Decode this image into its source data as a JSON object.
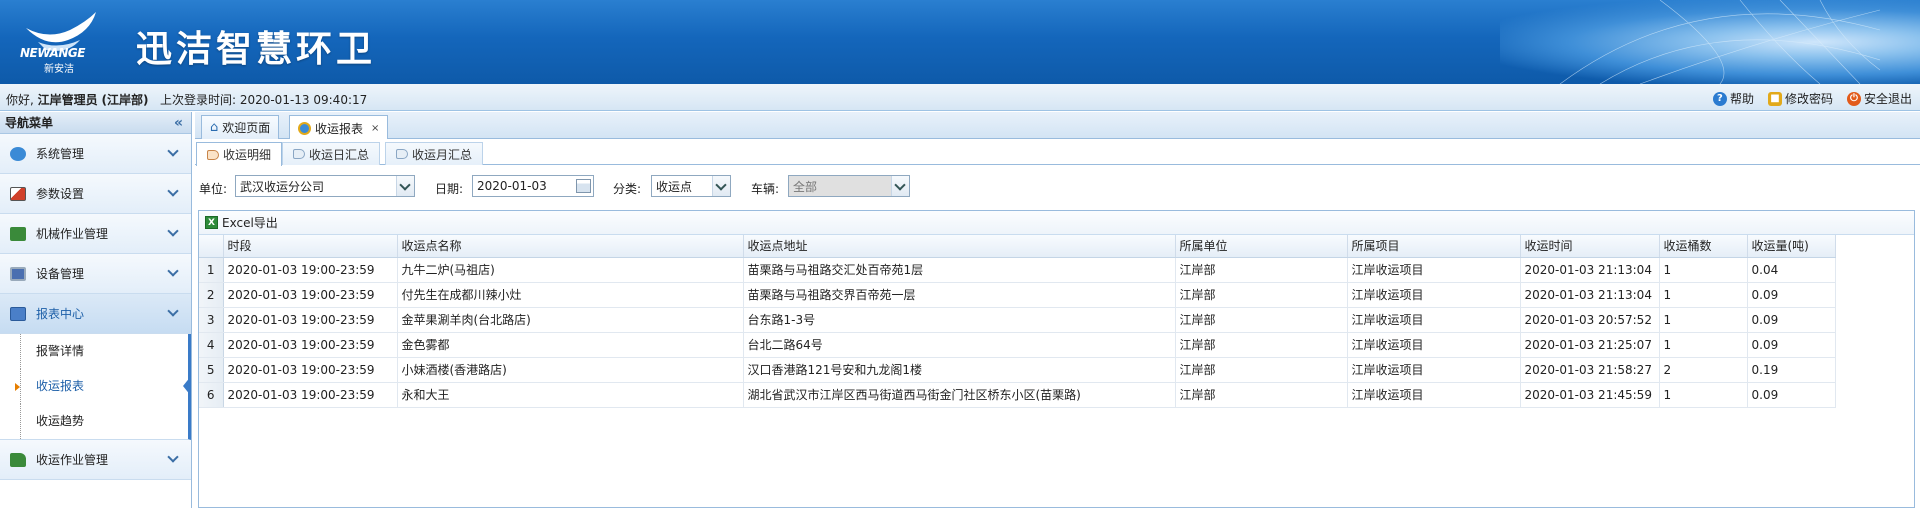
{
  "header": {
    "logo_text": "NEWANGE",
    "logo_sub": "新安洁",
    "app_title": "迅洁智慧环卫"
  },
  "infobar": {
    "greeting_prefix": "你好,",
    "user": "江岸管理员",
    "dept": "(江岸部)",
    "last_login_label": "上次登录时间:",
    "last_login": "2020-01-13 09:40:17",
    "links": [
      {
        "label": "帮助",
        "icon": "help-icon",
        "color": "#2b7bd0"
      },
      {
        "label": "修改密码",
        "icon": "lock-icon",
        "color": "#e2a91a"
      },
      {
        "label": "安全退出",
        "icon": "power-icon",
        "color": "#e25a1a"
      }
    ]
  },
  "sidebar": {
    "title": "导航菜单",
    "collapse_icon": "«",
    "items": [
      {
        "label": "系统管理",
        "icon": "system-icon",
        "color": "#3a8ad6"
      },
      {
        "label": "参数设置",
        "icon": "chart-params-icon",
        "color": "#d0402a"
      },
      {
        "label": "机械作业管理",
        "icon": "truck-icon",
        "color": "#3a8a3a"
      },
      {
        "label": "设备管理",
        "icon": "monitor-icon",
        "color": "#4a6fb0"
      },
      {
        "label": "报表中心",
        "icon": "report-icon",
        "color": "#4a7fc8"
      },
      {
        "label": "收运作业管理",
        "icon": "garbage-truck-icon",
        "color": "#3a8a3a"
      }
    ],
    "sub_items": [
      "报警详情",
      "收运报表",
      "收运趋势"
    ]
  },
  "tabs": [
    {
      "label": "欢迎页面",
      "icon": "home-icon"
    },
    {
      "label": "收运报表",
      "icon": "report-tab-icon",
      "close": "×"
    }
  ],
  "subtabs": [
    "收运明细",
    "收运日汇总",
    "收运月汇总"
  ],
  "filters": {
    "unit_label": "单位:",
    "unit_value": "武汉收运分公司",
    "date_label": "日期:",
    "date_value": "2020-01-03",
    "category_label": "分类:",
    "category_value": "收运点",
    "vehicle_label": "车辆:",
    "vehicle_value": "全部"
  },
  "toolbar": {
    "excel_label": "Excel导出"
  },
  "table": {
    "columns": [
      "时段",
      "收运点名称",
      "收运点地址",
      "所属单位",
      "所属项目",
      "收运时间",
      "收运桶数",
      "收运量(吨)"
    ],
    "rows": [
      [
        "1",
        "2020-01-03 19:00-23:59",
        "九牛二炉(马祖店)",
        "苗栗路与马祖路交汇处百帝苑1层",
        "江岸部",
        "江岸收运项目",
        "2020-01-03 21:13:04",
        "1",
        "0.04"
      ],
      [
        "2",
        "2020-01-03 19:00-23:59",
        "付先生在成都川辣小灶",
        "苗栗路与马祖路交界百帝苑一层",
        "江岸部",
        "江岸收运项目",
        "2020-01-03 21:13:04",
        "1",
        "0.09"
      ],
      [
        "3",
        "2020-01-03 19:00-23:59",
        "金苹果涮羊肉(台北路店)",
        "台东路1-3号",
        "江岸部",
        "江岸收运项目",
        "2020-01-03 20:57:52",
        "1",
        "0.09"
      ],
      [
        "4",
        "2020-01-03 19:00-23:59",
        "金色雾都",
        "台北二路64号",
        "江岸部",
        "江岸收运项目",
        "2020-01-03 21:25:07",
        "1",
        "0.09"
      ],
      [
        "5",
        "2020-01-03 19:00-23:59",
        "小妹酒楼(香港路店)",
        "汉口香港路121号安和九龙阁1楼",
        "江岸部",
        "江岸收运项目",
        "2020-01-03 21:58:27",
        "2",
        "0.19"
      ],
      [
        "6",
        "2020-01-03 19:00-23:59",
        "永和大王",
        "湖北省武汉市江岸区西马街道西马街金门社区桥东小区(苗栗路)",
        "江岸部",
        "江岸收运项目",
        "2020-01-03 21:45:59",
        "1",
        "0.09"
      ]
    ]
  }
}
